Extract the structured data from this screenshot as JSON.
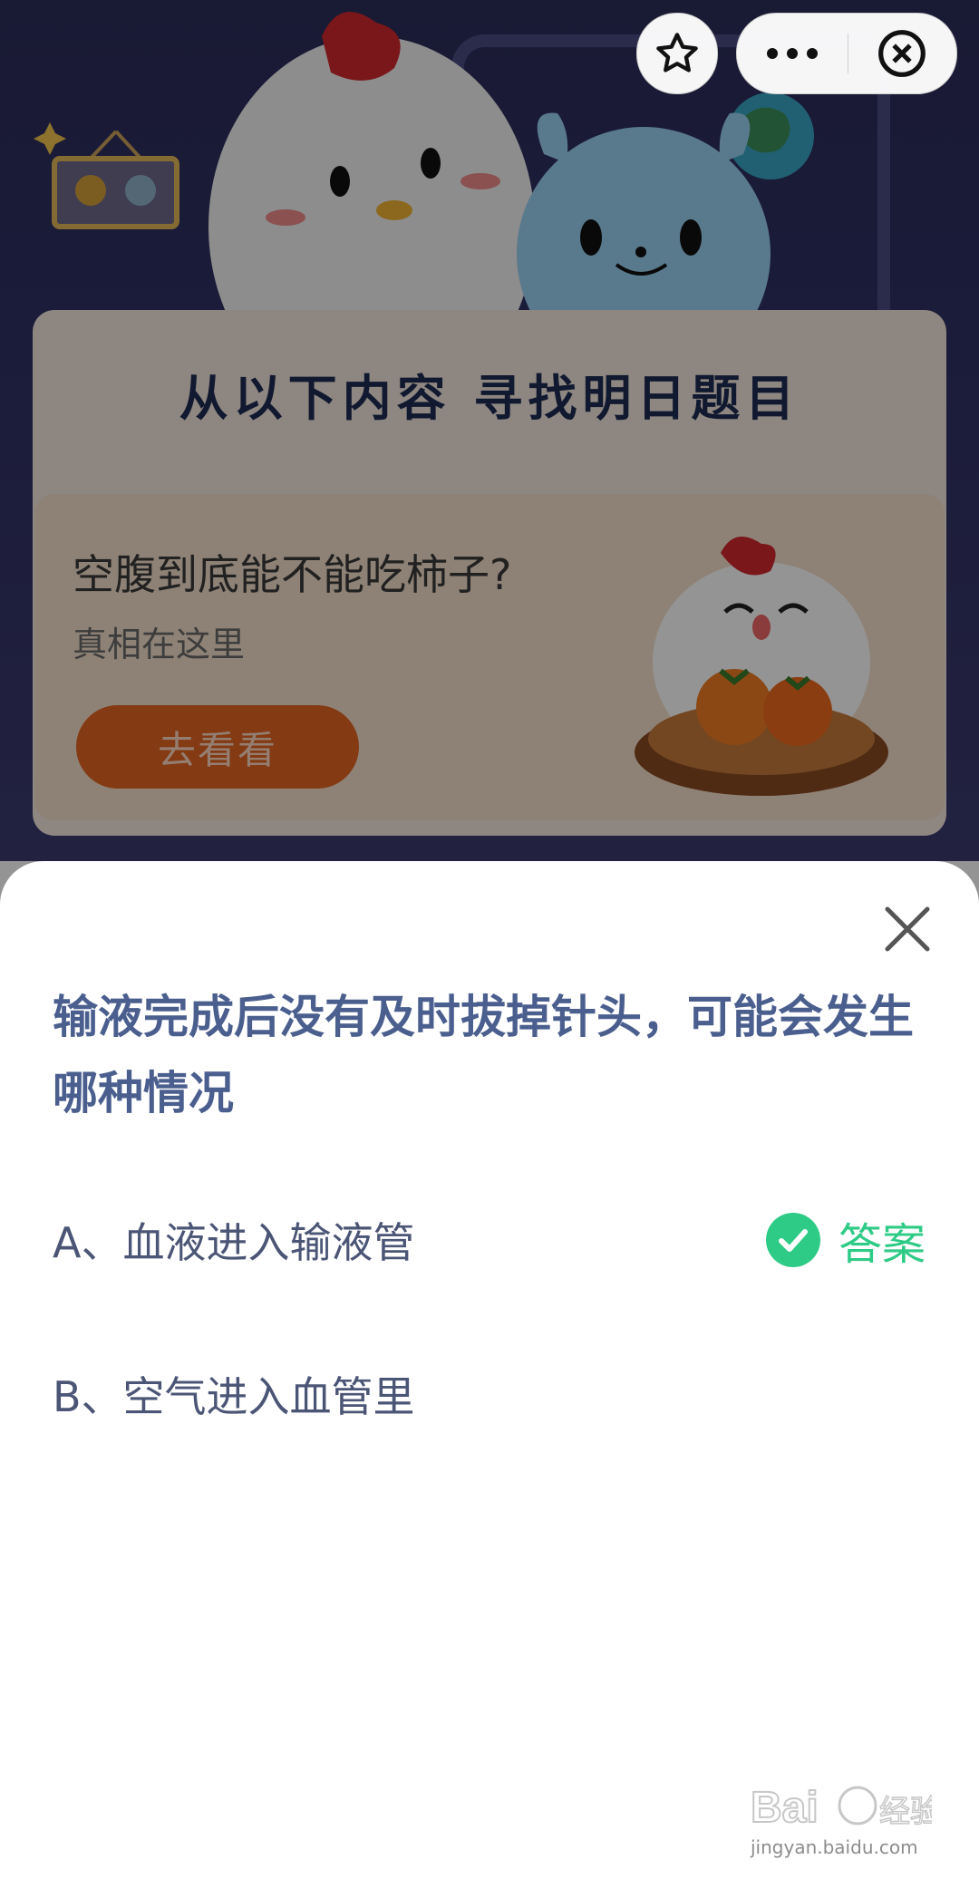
{
  "top_bar": {
    "favorite_icon": "star-icon",
    "more_icon": "more-dots-icon",
    "close_icon": "close-circle-icon"
  },
  "banner": {
    "title": "从以下内容  寻找明日题目"
  },
  "card": {
    "title": "空腹到底能不能吃柿子?",
    "subtitle": "真相在这里",
    "button_label": "去看看"
  },
  "sheet": {
    "question": "输液完成后没有及时拔掉针头，可能会发生哪种情况",
    "options": [
      {
        "label": "A、血液进入输液管",
        "is_answer": true
      },
      {
        "label": "B、空气进入血管里",
        "is_answer": false
      }
    ],
    "answer_label": "答案"
  },
  "colors": {
    "question": "#4b5f8f",
    "answer": "#2ecb86",
    "card_button": "#e3651f"
  },
  "watermark": {
    "text": "jingyan.baidu.com"
  }
}
